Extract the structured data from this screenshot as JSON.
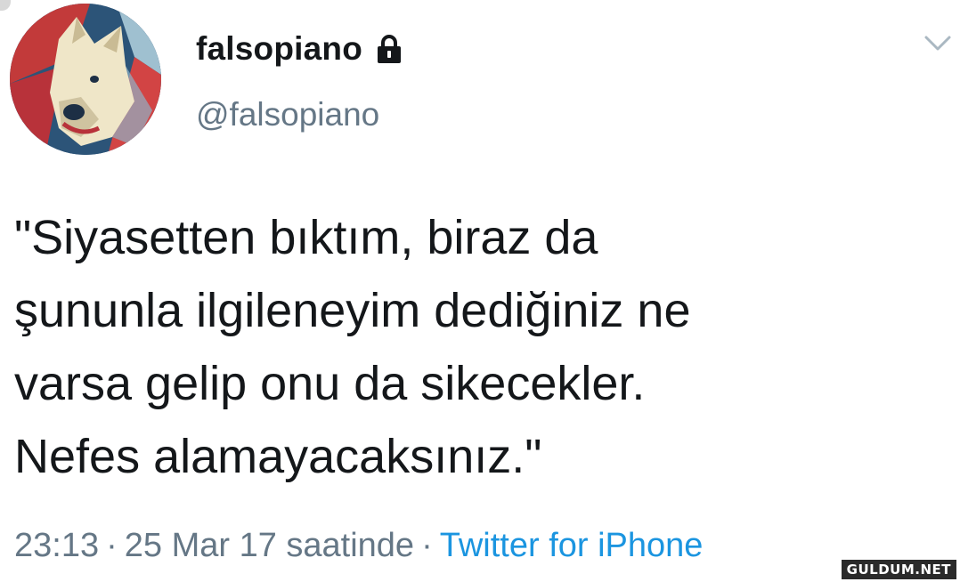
{
  "tweet": {
    "display_name": "falsopiano",
    "handle": "@falsopiano",
    "text_lines": [
      "\"Siyasetten bıktım, biraz da",
      "şununla ilgileneyim dediğiniz ne",
      "varsa gelip onu da sikecekler.",
      "Nefes alamayacaksınız.\""
    ],
    "time": "23:13",
    "date": "25 Mar 17 saatinde",
    "separator": "·",
    "source": "Twitter for iPhone",
    "protected_icon": "lock-icon",
    "menu_icon": "chevron-down-icon"
  },
  "watermark": "GULDUM.NET",
  "colors": {
    "text": "#14171a",
    "secondary": "#657786",
    "link": "#1b95e0"
  }
}
